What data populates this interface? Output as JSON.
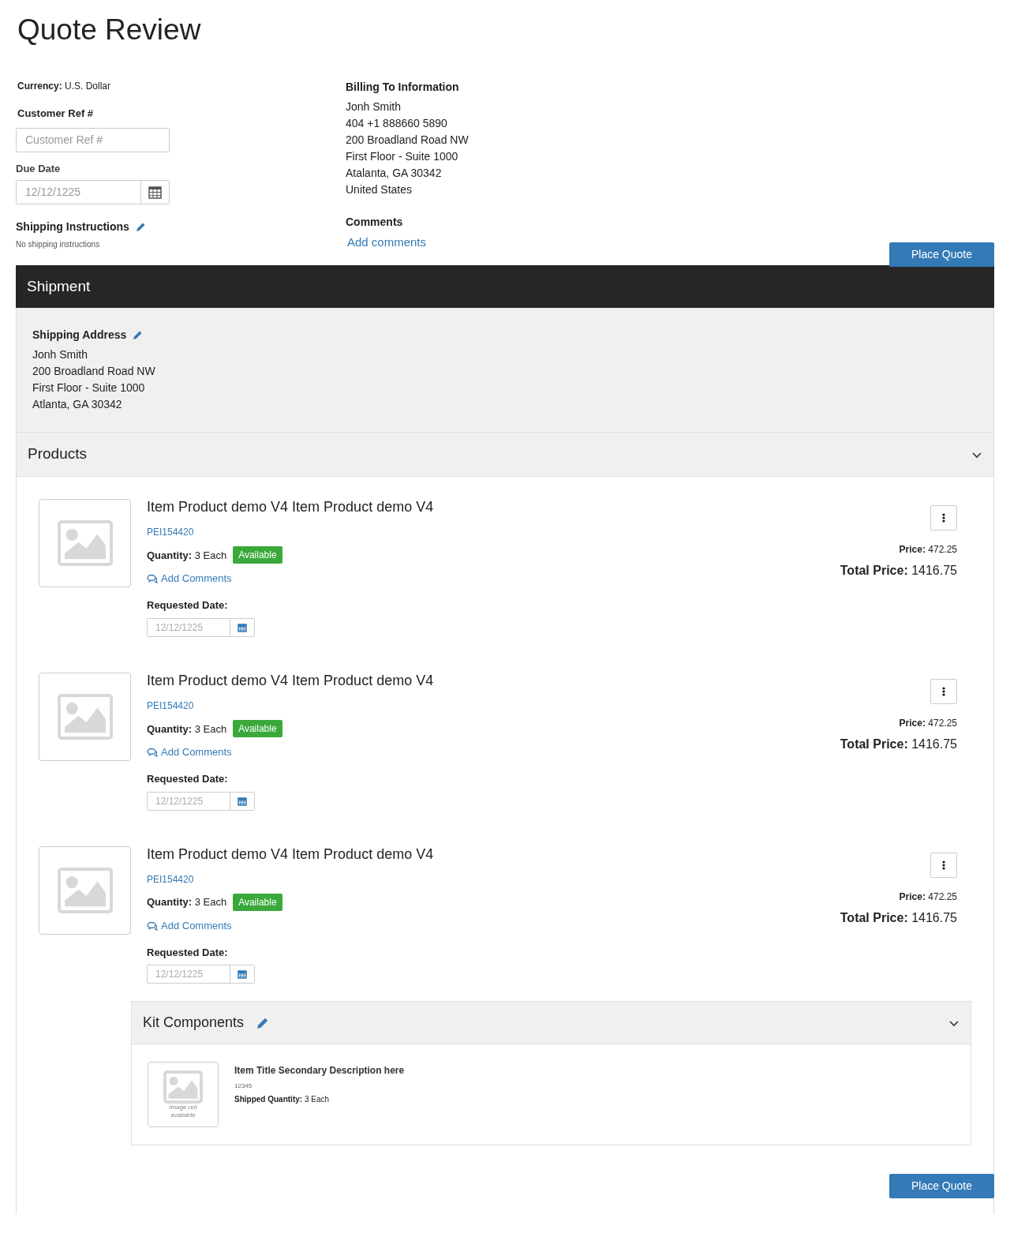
{
  "title": "Quote Review",
  "currency": {
    "label": "Currency:",
    "value": "U.S. Dollar"
  },
  "customer_ref": {
    "label": "Customer Ref #",
    "placeholder": "Customer Ref #"
  },
  "due_date": {
    "label": "Due Date",
    "placeholder": "12/12/1225"
  },
  "shipping_instructions": {
    "label": "Shipping Instructions",
    "text": "No shipping instructions"
  },
  "billing": {
    "heading": "Billing To Information",
    "lines": [
      "Jonh Smith",
      "404 +1 888660 5890",
      "200 Broadland Road NW",
      "First Floor - Suite 1000",
      "Atalanta, GA 30342",
      "United States"
    ]
  },
  "comments": {
    "heading": "Comments",
    "link": "Add comments"
  },
  "place_quote_top": "Place Quote",
  "shipment": {
    "title": "Shipment",
    "address_heading": "Shipping Address",
    "address_lines": [
      "Jonh Smith",
      "200 Broadland Road NW",
      "First Floor - Suite 1000",
      "Atlanta, GA 30342"
    ]
  },
  "products_section": {
    "title": "Products",
    "expanded": true
  },
  "products": [
    {
      "name": "Item Product demo V4 Item Product demo V4",
      "sku": "PEI154420",
      "quantity_label": "Quantity:",
      "quantity": "3 Each",
      "status": "Available",
      "comments_link": "Add Comments",
      "requested_label": "Requested Date:",
      "requested_placeholder": "12/12/1225",
      "price_label": "Price:",
      "price": "472.25",
      "total_label": "Total Price:",
      "total": "1416.75"
    },
    {
      "name": "Item Product demo V4 Item Product demo V4",
      "sku": "PEI154420",
      "quantity_label": "Quantity:",
      "quantity": "3 Each",
      "status": "Available",
      "comments_link": "Add Comments",
      "requested_label": "Requested Date:",
      "requested_placeholder": "12/12/1225",
      "price_label": "Price:",
      "price": "472.25",
      "total_label": "Total Price:",
      "total": "1416.75"
    },
    {
      "name": "Item Product demo V4 Item Product demo V4",
      "sku": "PEI154420",
      "quantity_label": "Quantity:",
      "quantity": "3 Each",
      "status": "Available",
      "comments_link": "Add Comments",
      "requested_label": "Requested Date:",
      "requested_placeholder": "12/12/1225",
      "price_label": "Price:",
      "price": "472.25",
      "total_label": "Total Price:",
      "total": "1416.75",
      "kit": {
        "title": "Kit Components",
        "expanded": true,
        "items": [
          {
            "image_text": "Image not available",
            "title": "Item Title Secondary Description here",
            "code": "12345",
            "shipped_label": "Shipped Quantity:",
            "shipped": "3 Each"
          }
        ]
      }
    }
  ],
  "place_quote_bottom": "Place Quote"
}
